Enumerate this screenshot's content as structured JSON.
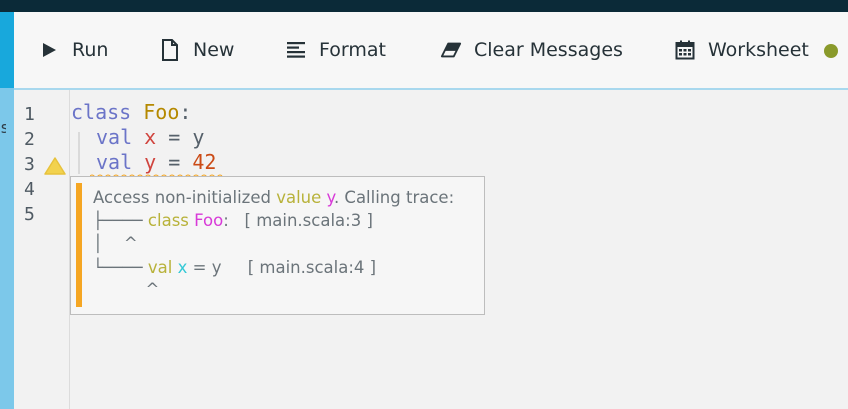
{
  "toolbar": {
    "run_label": "Run",
    "new_label": "New",
    "format_label": "Format",
    "clear_label": "Clear Messages",
    "worksheet_label": "Worksheet",
    "worksheet_status_color": "#8a9a2b",
    "icons": [
      "play-icon",
      "new-file-icon",
      "format-icon",
      "eraser-icon",
      "calendar-icon"
    ]
  },
  "editor": {
    "line_numbers": [
      "1",
      "2",
      "3",
      "4",
      "5"
    ],
    "lines": [
      {
        "t1": "class",
        "t2": " ",
        "t3": "Foo",
        "t4": ":"
      },
      {
        "t1": "val",
        "t2": " ",
        "t3": "x",
        "t4": " = ",
        "t5": "y"
      },
      {
        "t1": "val",
        "t2": " ",
        "t3": "y",
        "t4": " = ",
        "t5": "42"
      }
    ],
    "warning_line": "3"
  },
  "tooltip": {
    "msg_prefix": "Access non-initialized ",
    "msg_kw": "value",
    "msg_var": " y",
    "msg_suffix": ". Calling trace:",
    "trace1_branch": "├──── ",
    "trace1_kw": "class",
    "trace1_type": " Foo",
    "trace1_rest": ":   [ main.scala:3 ]",
    "trace2": "│    ^",
    "trace3_branch": "└──── ",
    "trace3_kw": "val",
    "trace3_var": " x",
    "trace3_rest": " = y     [ main.scala:4 ]",
    "trace4": "          ^"
  },
  "colors": {
    "accent": "#18a8dc",
    "warning": "#f5a623",
    "header": "#0b2a38"
  }
}
